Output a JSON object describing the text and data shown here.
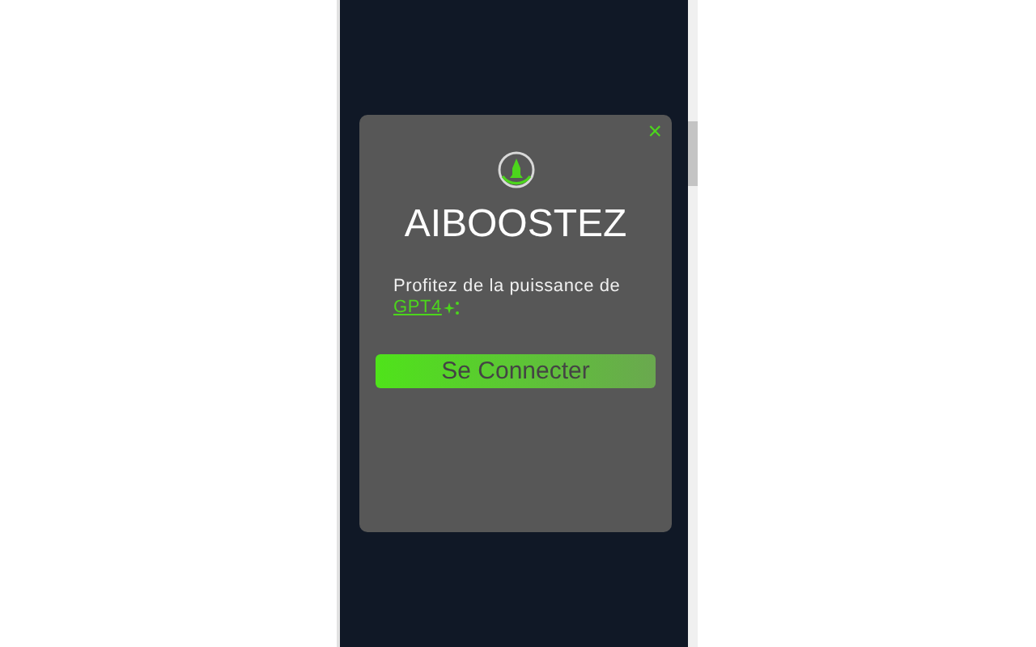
{
  "modal": {
    "close": "×",
    "title": "AIBOOSTEZ",
    "text": "Profitez de la puissance de",
    "link": "GPT4",
    "button": "Se Connecter"
  }
}
